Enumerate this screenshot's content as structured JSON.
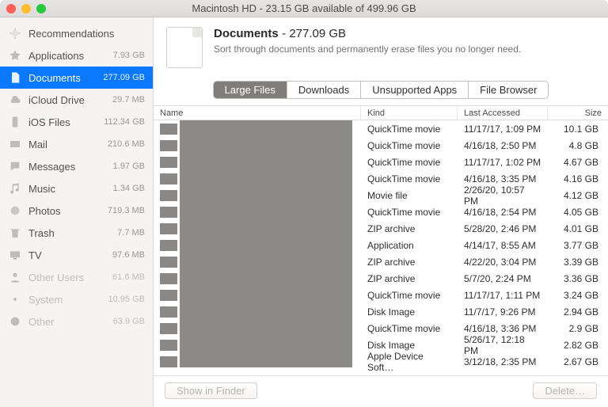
{
  "titlebar": "Macintosh HD - 23.15 GB available of 499.96 GB",
  "sidebar": {
    "items": [
      {
        "label": "Recommendations",
        "val": "",
        "kind": "rec"
      },
      {
        "label": "Applications",
        "val": "7.93 GB"
      },
      {
        "label": "Documents",
        "val": "277.09 GB",
        "sel": true
      },
      {
        "label": "iCloud Drive",
        "val": "29.7 MB"
      },
      {
        "label": "iOS Files",
        "val": "112.34 GB"
      },
      {
        "label": "Mail",
        "val": "210.6 MB"
      },
      {
        "label": "Messages",
        "val": "1.97 GB"
      },
      {
        "label": "Music",
        "val": "1.34 GB"
      },
      {
        "label": "Photos",
        "val": "719.3 MB"
      },
      {
        "label": "Trash",
        "val": "7.7 MB"
      },
      {
        "label": "TV",
        "val": "97.6 MB"
      },
      {
        "label": "Other Users",
        "val": "61.6 MB",
        "muted": true
      },
      {
        "label": "System",
        "val": "10.95 GB",
        "muted": true
      },
      {
        "label": "Other",
        "val": "63.9 GB",
        "muted": true
      }
    ]
  },
  "header": {
    "title": "Documents",
    "size": "277.09 GB",
    "subtitle": "Sort through documents and permanently erase files you no longer need."
  },
  "tabs": [
    "Large Files",
    "Downloads",
    "Unsupported Apps",
    "File Browser"
  ],
  "columns": {
    "name": "Name",
    "kind": "Kind",
    "date": "Last Accessed",
    "size": "Size"
  },
  "rows": [
    {
      "kind": "QuickTime movie",
      "date": "11/17/17, 1:09 PM",
      "size": "10.1 GB"
    },
    {
      "kind": "QuickTime movie",
      "date": "4/16/18, 2:50 PM",
      "size": "4.8 GB"
    },
    {
      "kind": "QuickTime movie",
      "date": "11/17/17, 1:02 PM",
      "size": "4.67 GB"
    },
    {
      "kind": "QuickTime movie",
      "date": "4/16/18, 3:35 PM",
      "size": "4.16 GB"
    },
    {
      "kind": "Movie file",
      "date": "2/26/20, 10:57 PM",
      "size": "4.12 GB"
    },
    {
      "kind": "QuickTime movie",
      "date": "4/16/18, 2:54 PM",
      "size": "4.05 GB"
    },
    {
      "kind": "ZIP archive",
      "date": "5/28/20, 2:46 PM",
      "size": "4.01 GB"
    },
    {
      "kind": "Application",
      "date": "4/14/17, 8:55 AM",
      "size": "3.77 GB"
    },
    {
      "kind": "ZIP archive",
      "date": "4/22/20, 3:04 PM",
      "size": "3.39 GB"
    },
    {
      "kind": "ZIP archive",
      "date": "5/7/20, 2:24 PM",
      "size": "3.36 GB"
    },
    {
      "kind": "QuickTime movie",
      "date": "11/17/17, 1:11 PM",
      "size": "3.24 GB"
    },
    {
      "kind": "Disk Image",
      "date": "11/7/17, 9:26 PM",
      "size": "2.94 GB"
    },
    {
      "kind": "QuickTime movie",
      "date": "4/16/18, 3:36 PM",
      "size": "2.9 GB"
    },
    {
      "kind": "Disk Image",
      "date": "5/26/17, 12:18 PM",
      "size": "2.82 GB"
    },
    {
      "kind": "Apple Device Soft…",
      "date": "3/12/18, 2:35 PM",
      "size": "2.67 GB"
    }
  ],
  "footer": {
    "show": "Show in Finder",
    "del": "Delete…"
  }
}
